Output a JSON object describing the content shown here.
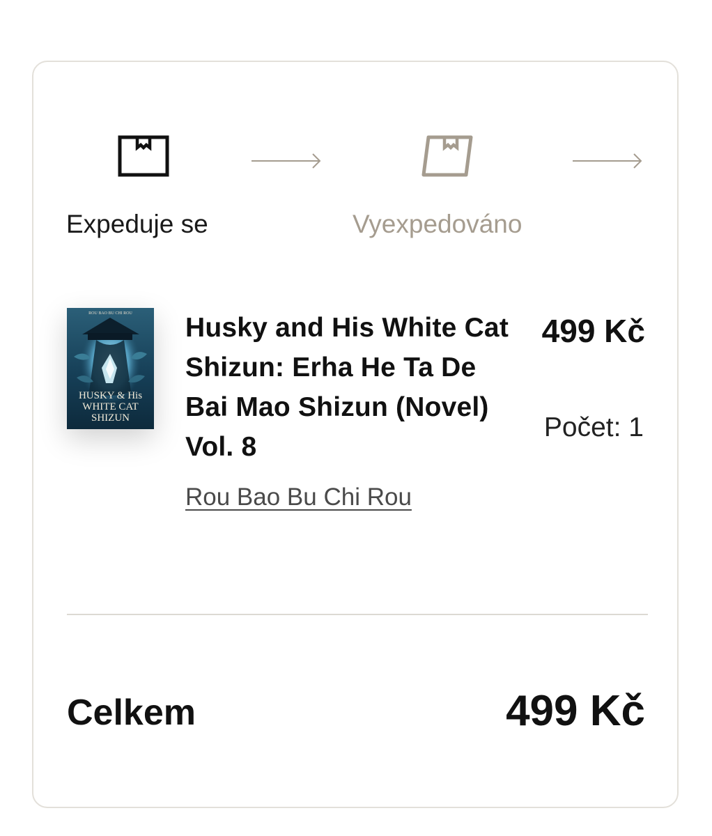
{
  "status_steps": [
    {
      "label": "Expeduje se",
      "icon": "package-icon",
      "state": "active",
      "color": "#1a1a1a"
    },
    {
      "label": "Vyexpedováno",
      "icon": "package-shipped-icon",
      "state": "inactive",
      "color": "#a59c8f"
    }
  ],
  "arrow_color": "#a59c8f",
  "item": {
    "title": "Husky and His White Cat Shizun: Erha He Ta De Bai Mao Shizun (Novel) Vol. 8",
    "author": "Rou Bao Bu Chi Rou",
    "price": "499 Kč",
    "quantity": "Počet: 1",
    "cover": {
      "author_text": "ROU BAO BU CHI ROU",
      "title_text": "HUSKY & HIS WHITE CAT SHIZUN"
    }
  },
  "total": {
    "label": "Celkem",
    "value": "499 Kč"
  }
}
